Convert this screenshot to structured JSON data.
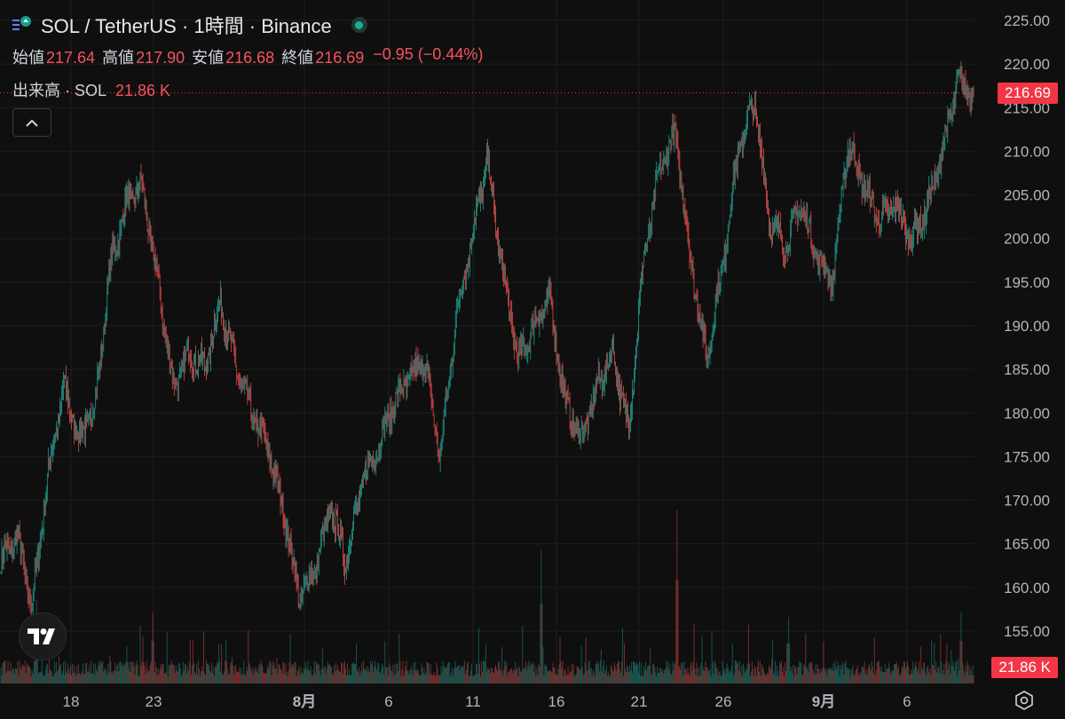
{
  "header": {
    "title": "SOL / TetherUS · 1時間 · Binance",
    "logo_icon": "solana-coin-icon",
    "status_icon": "market-open-dot-icon"
  },
  "ohlc": {
    "open_label": "始値",
    "open": "217.64",
    "high_label": "高値",
    "high": "217.90",
    "low_label": "安値",
    "low": "216.68",
    "close_label": "終値",
    "close": "216.69",
    "change": "−0.95 (−0.44%)"
  },
  "volume": {
    "label": "出来高 · SOL",
    "value": "21.86 K"
  },
  "price_tag": "216.69",
  "volume_tag": "21.86 K",
  "colors": {
    "up": "#26a69a",
    "down": "#ef5350",
    "background": "#0f0f0f",
    "grid": "#1f1f1f",
    "tag": "#f23645"
  },
  "chart_data": {
    "type": "candlestick",
    "interval": "1時間",
    "y_axis": {
      "ticks": [
        "225.00",
        "220.00",
        "215.00",
        "210.00",
        "205.00",
        "200.00",
        "195.00",
        "190.00",
        "185.00",
        "180.00",
        "175.00",
        "170.00",
        "165.00",
        "160.00",
        "155.00"
      ],
      "range": [
        152,
        226
      ],
      "position": "right"
    },
    "x_axis": {
      "ticks": [
        "18",
        "23",
        "8月",
        "6",
        "11",
        "16",
        "21",
        "26",
        "9月",
        "6"
      ],
      "bold_ticks": [
        "8月",
        "9月"
      ]
    },
    "last_price": 216.69,
    "approx_close_path": [
      [
        "Jul 16",
        163
      ],
      [
        "Jul 17",
        166
      ],
      [
        "Jul 17",
        158
      ],
      [
        "Jul 19",
        173
      ],
      [
        "Jul 19",
        183
      ],
      [
        "Jul 21",
        177
      ],
      [
        "Jul 22",
        181
      ],
      [
        "Jul 23",
        197
      ],
      [
        "Jul 23",
        204
      ],
      [
        "Jul 24",
        206
      ],
      [
        "Jul 25",
        195
      ],
      [
        "Jul 27",
        183
      ],
      [
        "Jul 28",
        187
      ],
      [
        "Jul 29",
        185
      ],
      [
        "Jul 30",
        193
      ],
      [
        "Jul 31",
        185
      ],
      [
        "Aug 1",
        180
      ],
      [
        "Aug 1",
        176
      ],
      [
        "Aug 2",
        169
      ],
      [
        "Aug 3",
        159
      ],
      [
        "Aug 4",
        162
      ],
      [
        "Aug 5",
        169
      ],
      [
        "Aug 6",
        163
      ],
      [
        "Aug 7",
        172
      ],
      [
        "Aug 8",
        176
      ],
      [
        "Aug 9",
        181
      ],
      [
        "Aug 10",
        184
      ],
      [
        "Aug 11",
        186
      ],
      [
        "Aug 12",
        175
      ],
      [
        "Aug 13",
        191
      ],
      [
        "Aug 14",
        200
      ],
      [
        "Aug 14",
        209
      ],
      [
        "Aug 15",
        196
      ],
      [
        "Aug 16",
        186
      ],
      [
        "Aug 17",
        190
      ],
      [
        "Aug 18",
        193
      ],
      [
        "Aug 19",
        181
      ],
      [
        "Aug 20",
        177
      ],
      [
        "Aug 21",
        183
      ],
      [
        "Aug 22",
        187
      ],
      [
        "Aug 23",
        178
      ],
      [
        "Aug 23",
        198
      ],
      [
        "Aug 24",
        208
      ],
      [
        "Aug 25",
        212
      ],
      [
        "Aug 26",
        197
      ],
      [
        "Aug 26",
        186
      ],
      [
        "Aug 27",
        197
      ],
      [
        "Aug 28",
        210
      ],
      [
        "Aug 29",
        216
      ],
      [
        "Aug 30",
        202
      ],
      [
        "Aug 31",
        199
      ],
      [
        "Sep 1",
        204
      ],
      [
        "Sep 2",
        198
      ],
      [
        "Sep 3",
        195
      ],
      [
        "Sep 4",
        211
      ],
      [
        "Sep 5",
        206
      ],
      [
        "Sep 6",
        202
      ],
      [
        "Sep 7",
        204
      ],
      [
        "Sep 8",
        200
      ],
      [
        "Sep 9",
        203
      ],
      [
        "Sep 9",
        210
      ],
      [
        "Sep 10",
        218
      ],
      [
        "Sep 10",
        216.69
      ]
    ],
    "volume_unit": "K",
    "last_volume": 21.86
  }
}
